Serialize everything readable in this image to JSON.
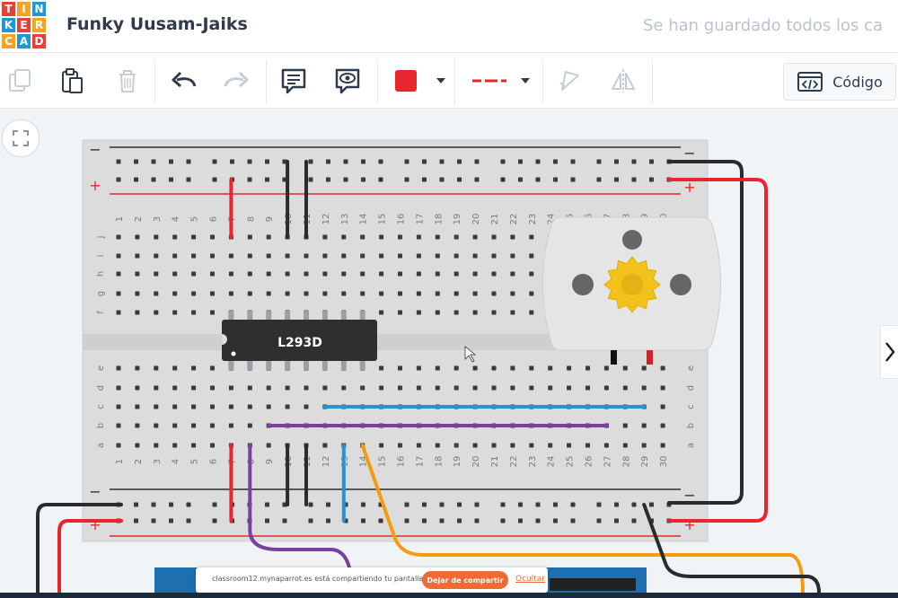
{
  "header": {
    "logo_letters": [
      "T",
      "I",
      "N",
      "K",
      "E",
      "R",
      "C",
      "A",
      "D"
    ],
    "logo_colors": [
      "#e2423a",
      "#f4a424",
      "#2196d3",
      "#2196d3",
      "#e2423a",
      "#f4a424",
      "#f4a424",
      "#2196d3",
      "#e2423a"
    ],
    "project_title": "Funky Uusam-Jaiks",
    "save_status": "Se han guardado todos los ca"
  },
  "toolbar": {
    "tools": [
      {
        "name": "copy-icon",
        "enabled": false
      },
      {
        "name": "paste-icon",
        "enabled": true
      },
      {
        "name": "delete-icon",
        "enabled": false
      },
      {
        "name": "undo-icon",
        "enabled": true
      },
      {
        "name": "redo-icon",
        "enabled": false
      },
      {
        "name": "notes-icon",
        "enabled": true
      },
      {
        "name": "view-notes-icon",
        "enabled": true
      },
      {
        "name": "wire-color-swatch",
        "color": "#e8262d"
      },
      {
        "name": "wire-type-selector",
        "color": "#e8262d"
      },
      {
        "name": "rotate-icon",
        "enabled": false
      },
      {
        "name": "flip-icon",
        "enabled": false
      }
    ],
    "code_label": "Código"
  },
  "canvas": {
    "fit_icon": "fit-view-icon",
    "breadboard": {
      "column_numbers": [
        "1",
        "2",
        "3",
        "4",
        "5",
        "6",
        "7",
        "8",
        "9",
        "10",
        "11",
        "12",
        "13",
        "14",
        "15",
        "16",
        "17",
        "18",
        "19",
        "20",
        "21",
        "22",
        "23",
        "24",
        "25",
        "26",
        "27",
        "28",
        "29",
        "30"
      ],
      "row_letters_top": [
        "j",
        "i",
        "h",
        "g",
        "f"
      ],
      "row_letters_bottom": [
        "e",
        "d",
        "c",
        "b",
        "a"
      ],
      "rail_minus": "−",
      "rail_plus": "+"
    },
    "chip_label": "L293D",
    "motor": "dc-motor",
    "colors": {
      "wire_red": "#e8262d",
      "wire_black": "#2b2b2b",
      "wire_blue": "#1f97d5",
      "wire_purple": "#7b3fa0",
      "wire_orange": "#f39c12",
      "gear": "#f2c21b"
    },
    "side_toggle": "chevron-right-icon"
  },
  "share_banner": {
    "text": "classroom12.mynaparrot.es está compartiendo tu pantalla.",
    "stop_label": "Dejar de compartir",
    "hide_label": "Ocultar"
  }
}
